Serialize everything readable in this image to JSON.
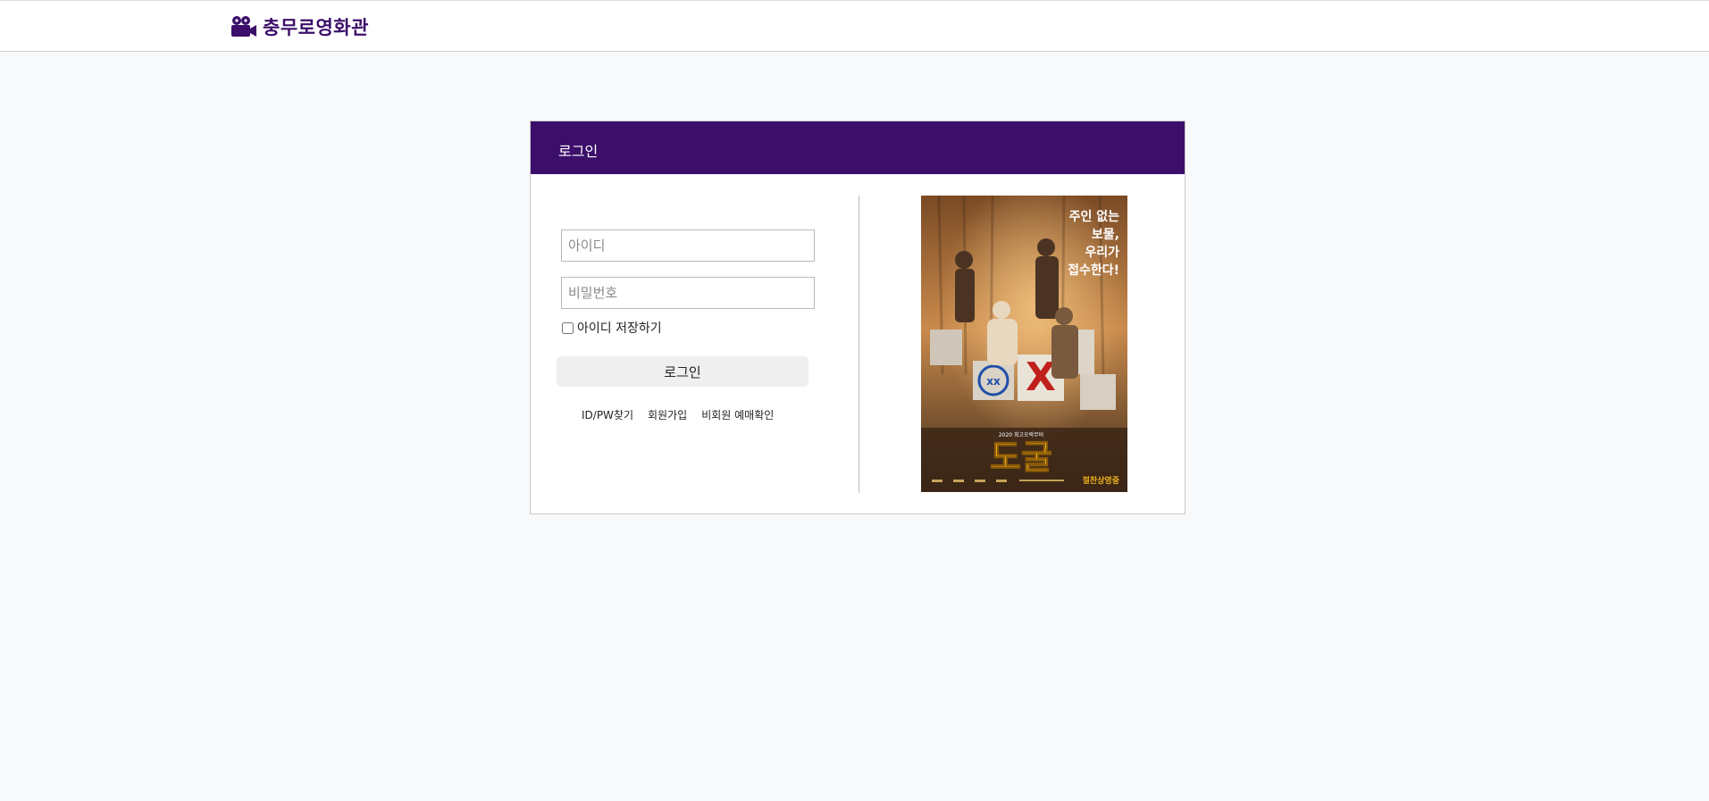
{
  "header": {
    "brand_name": "충무로영화관",
    "brand_icon": "movie-camera-icon",
    "brand_color": "#3c0f6a"
  },
  "login": {
    "title": "로그인",
    "id_placeholder": "아이디",
    "pw_placeholder": "비밀번호",
    "remember_label": "아이디 저장하기",
    "remember_checked": false,
    "submit_label": "로그인",
    "links": {
      "find": "ID/PW찾기",
      "signup": "회원가입",
      "guest": "비회원 예매확인"
    }
  },
  "poster": {
    "tagline_lines": [
      "주인 없는",
      "보물,",
      "우리가",
      "접수한다!"
    ],
    "movie_title": "도굴",
    "year_line": "2020 최고오락무비",
    "release": "절찬상영중"
  },
  "colors": {
    "accent": "#3c0f6a",
    "page_bg": "#f8f9fa",
    "button_bg": "#efefef"
  }
}
